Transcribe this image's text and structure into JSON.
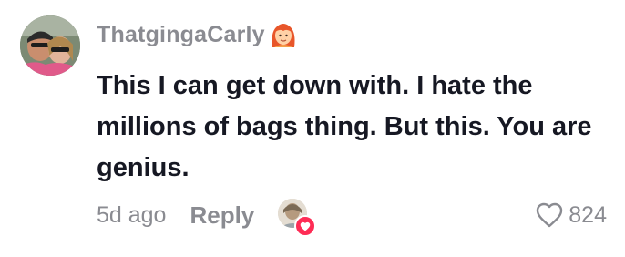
{
  "comment": {
    "username": "ThatgingaCarly",
    "username_emoji": "red-haired-woman-emoji",
    "text": "This I can get down with. I hate the millions of bags thing. But this. You are genius.",
    "timestamp": "5d ago",
    "reply_label": "Reply",
    "like_count": "824"
  },
  "icons": {
    "like": "heart-outline-icon",
    "liked_by_creator": "heart-badge-icon"
  },
  "colors": {
    "text_primary": "#161823",
    "text_secondary": "#8a8b91",
    "accent": "#fe2c55"
  }
}
